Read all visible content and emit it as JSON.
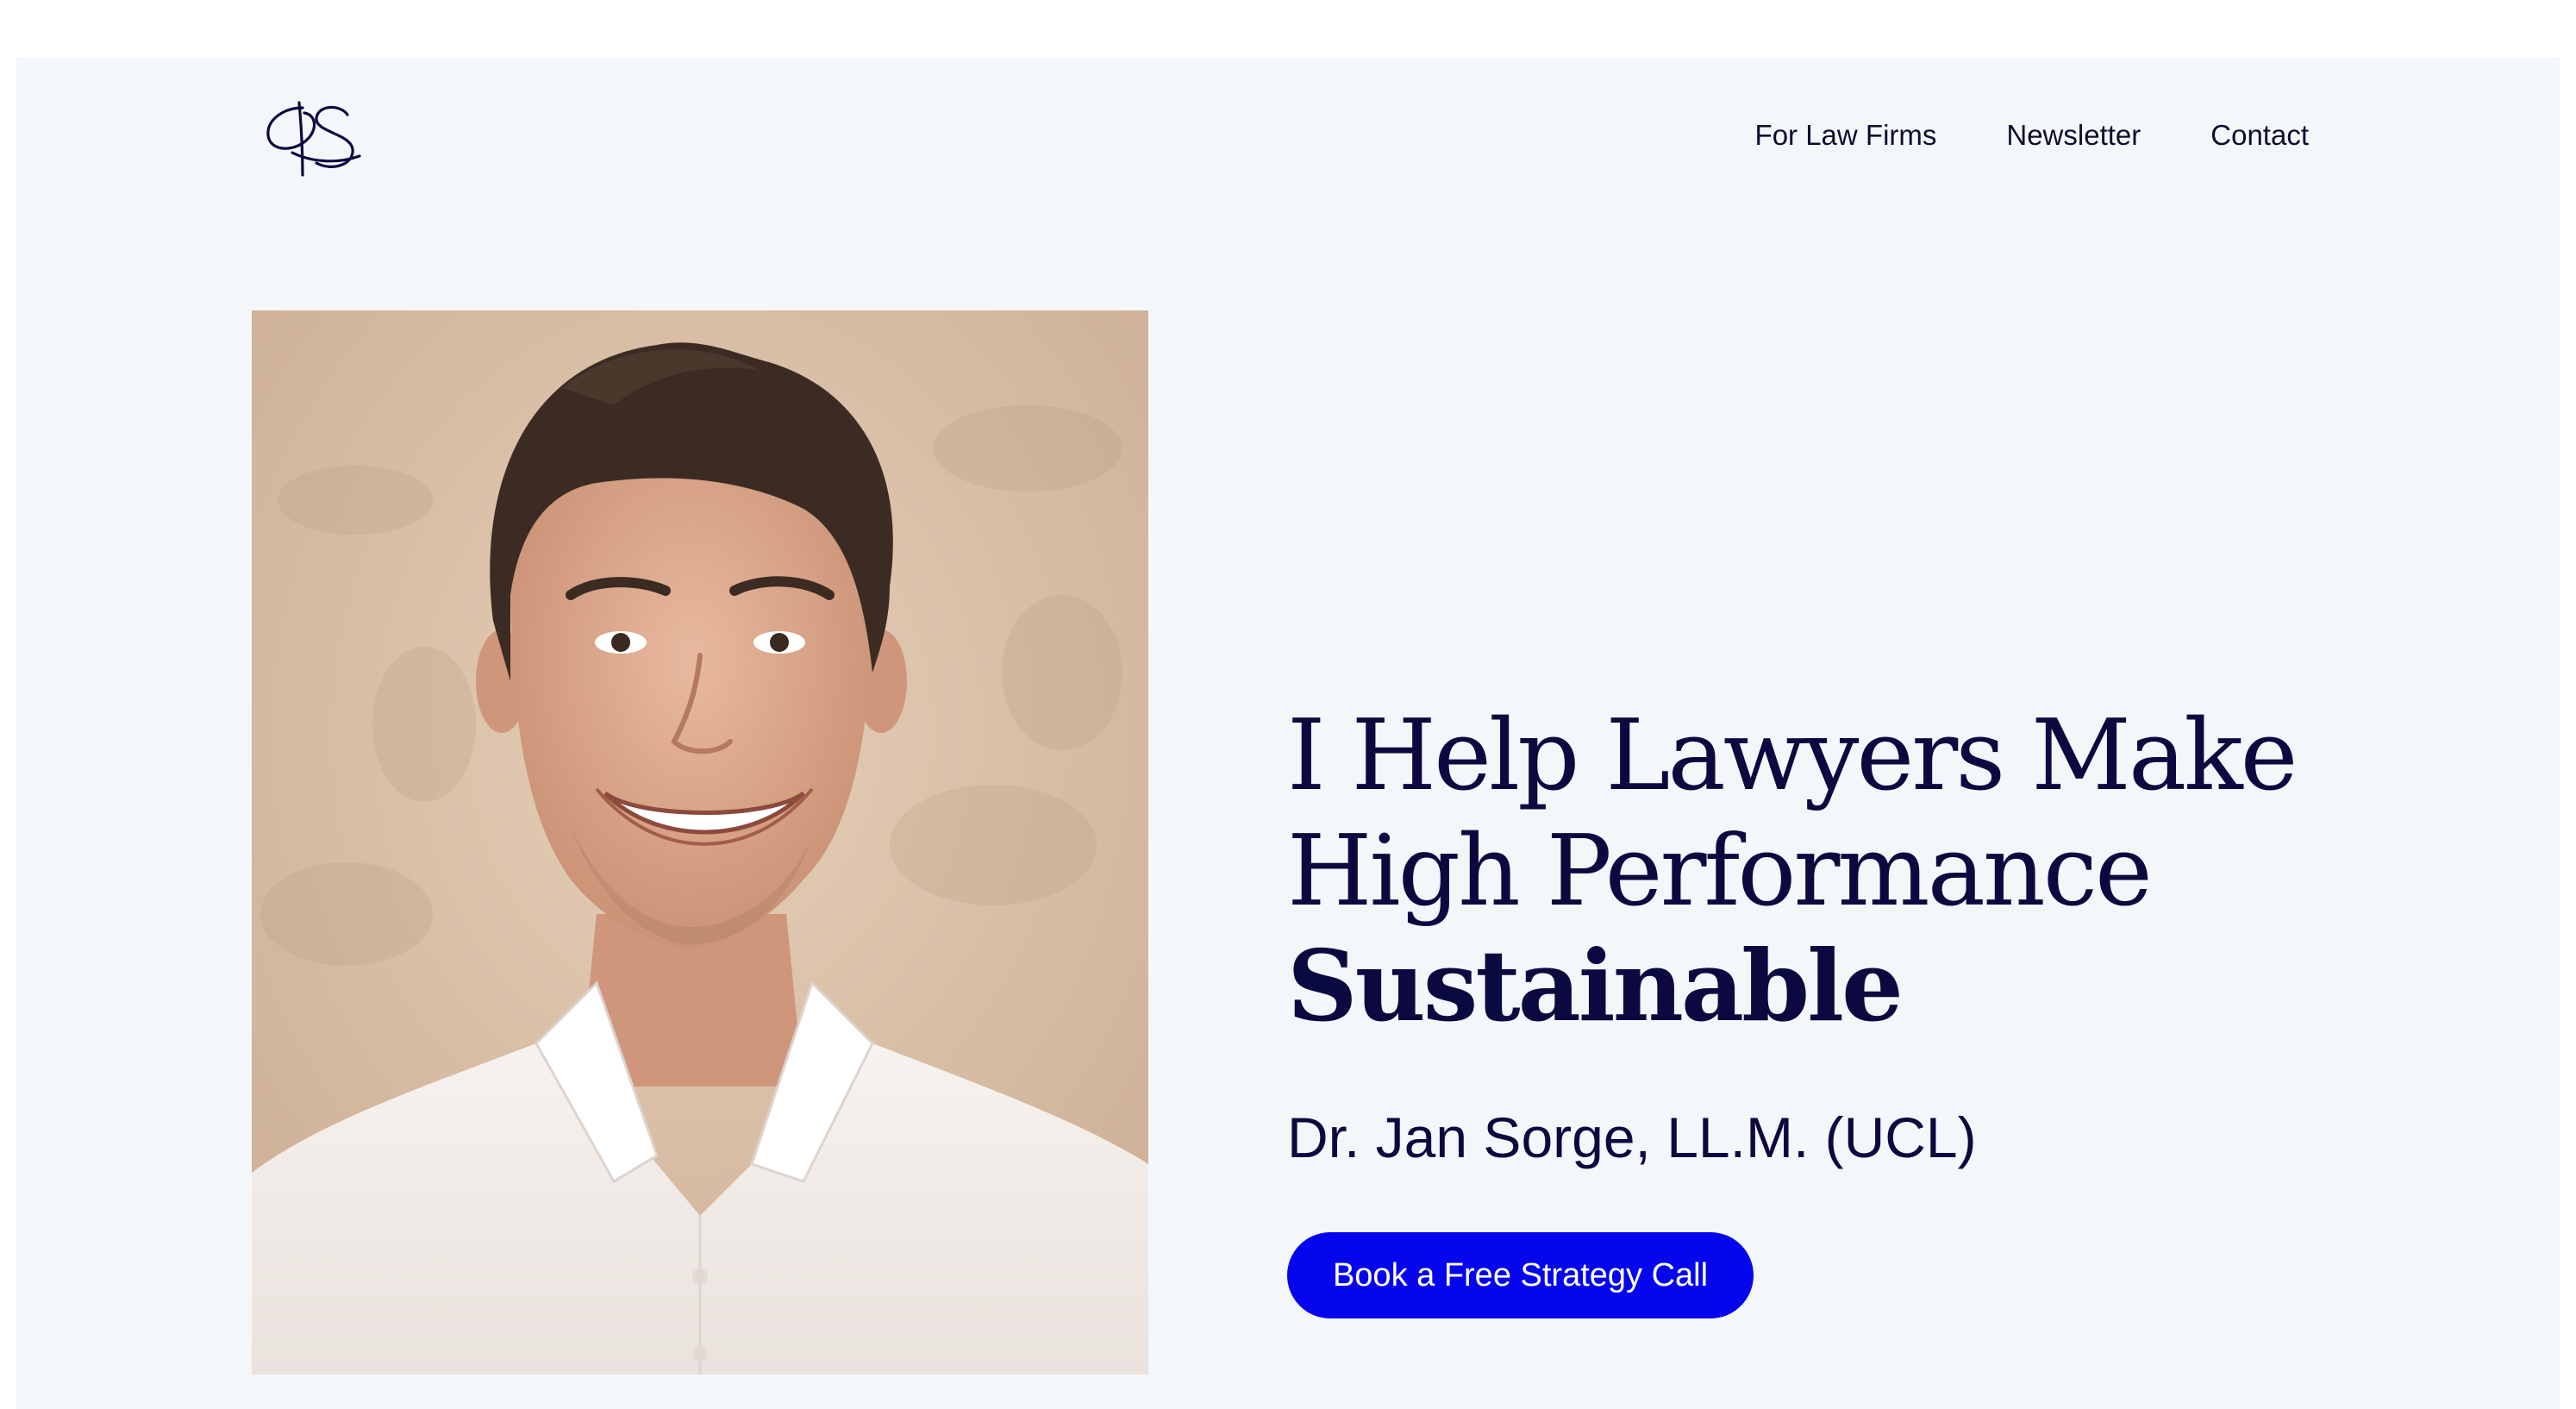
{
  "brand": {
    "logo_monogram": "JS",
    "logo_color": "#0b0a40"
  },
  "nav": {
    "items": [
      {
        "label": "For Law Firms"
      },
      {
        "label": "Newsletter"
      },
      {
        "label": "Contact"
      }
    ]
  },
  "hero": {
    "headline_line1": "I Help Lawyers Make",
    "headline_line2": "High Performance",
    "headline_line3": "Sustainable",
    "subtitle": "Dr. Jan Sorge, LL.M. (UCL)",
    "cta_label": "Book a Free Strategy Call",
    "photo_alt": "Portrait of a smiling man in a white shirt",
    "accent_color": "#0505ee",
    "text_color": "#0b0a40",
    "background_color": "#f3f7fa"
  }
}
